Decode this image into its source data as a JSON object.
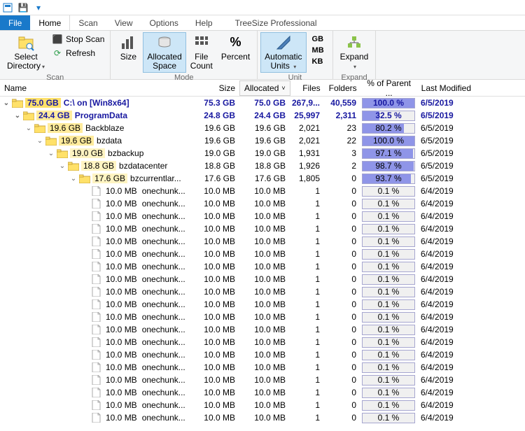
{
  "qa": {
    "save": "💾",
    "undo": "↶",
    "redo": "↷"
  },
  "menu": {
    "file": "File",
    "home": "Home",
    "scan": "Scan",
    "view": "View",
    "options": "Options",
    "help": "Help",
    "title": "TreeSize Professional"
  },
  "ribbon": {
    "select_dir": "Select\nDirectory",
    "stop_scan": "Stop Scan",
    "refresh": "Refresh",
    "scan_label": "Scan",
    "size": "Size",
    "alloc_space": "Allocated\nSpace",
    "file_count": "File\nCount",
    "percent": "Percent",
    "mode_label": "Mode",
    "auto_units": "Automatic\nUnits",
    "gb": "GB",
    "mb": "MB",
    "kb": "KB",
    "unit_label": "Unit",
    "expand": "Expand",
    "expand_label": "Expand"
  },
  "columns": {
    "name": "Name",
    "size": "Size",
    "alloc": "Allocated",
    "files": "Files",
    "folders": "Folders",
    "pct": "% of Parent ...",
    "mod": "Last Modified"
  },
  "rows": [
    {
      "type": "folder",
      "depth": 0,
      "chev": "v",
      "bg": "yellow",
      "bold": true,
      "size": "75.0 GB",
      "name": "C:\\ on  [Win8x64]",
      "c_size": "75.3 GB",
      "alloc": "75.0 GB",
      "files": "267,9...",
      "folders": "40,559",
      "pct": "100.0 %",
      "fill": 100,
      "mod": "6/5/2019"
    },
    {
      "type": "folder",
      "depth": 1,
      "chev": "v",
      "bg": "ltyellow",
      "bold": true,
      "size": "24.4 GB",
      "name": "ProgramData",
      "c_size": "24.8 GB",
      "alloc": "24.4 GB",
      "files": "25,997",
      "folders": "2,311",
      "pct": "32.5 %",
      "fill": 32.5,
      "mod": "6/5/2019"
    },
    {
      "type": "folder",
      "depth": 2,
      "chev": "v",
      "bg": "ltyellow",
      "bold": false,
      "size": "19.6 GB",
      "name": "Backblaze",
      "c_size": "19.6 GB",
      "alloc": "19.6 GB",
      "files": "2,021",
      "folders": "23",
      "pct": "80.2 %",
      "fill": 80.2,
      "mod": "6/5/2019"
    },
    {
      "type": "folder",
      "depth": 3,
      "chev": "v",
      "bg": "ltyellow",
      "bold": false,
      "size": "19.6 GB",
      "name": "bzdata",
      "c_size": "19.6 GB",
      "alloc": "19.6 GB",
      "files": "2,021",
      "folders": "22",
      "pct": "100.0 %",
      "fill": 100,
      "mod": "6/5/2019"
    },
    {
      "type": "folder",
      "depth": 4,
      "chev": "v",
      "bg": "vlyellow",
      "bold": false,
      "size": "19.0 GB",
      "name": "bzbackup",
      "c_size": "19.0 GB",
      "alloc": "19.0 GB",
      "files": "1,931",
      "folders": "3",
      "pct": "97.1 %",
      "fill": 97.1,
      "mod": "6/5/2019"
    },
    {
      "type": "folder",
      "depth": 5,
      "chev": "v",
      "bg": "vlyellow",
      "bold": false,
      "size": "18.8 GB",
      "name": "bzdatacenter",
      "c_size": "18.8 GB",
      "alloc": "18.8 GB",
      "files": "1,926",
      "folders": "2",
      "pct": "98.7 %",
      "fill": 98.7,
      "mod": "6/5/2019"
    },
    {
      "type": "folder",
      "depth": 6,
      "chev": "v",
      "bg": "vlyellow",
      "bold": false,
      "size": "17.6 GB",
      "name": "bzcurrentlar...",
      "c_size": "17.6 GB",
      "alloc": "17.6 GB",
      "files": "1,805",
      "folders": "0",
      "pct": "93.7 %",
      "fill": 93.7,
      "mod": "6/5/2019"
    },
    {
      "type": "file",
      "depth": 7,
      "size": "10.0 MB",
      "name": "onechunk...",
      "c_size": "10.0 MB",
      "alloc": "10.0 MB",
      "files": "1",
      "folders": "0",
      "pct": "0.1 %",
      "fill": 0.1,
      "mod": "6/4/2019"
    },
    {
      "type": "file",
      "depth": 7,
      "size": "10.0 MB",
      "name": "onechunk...",
      "c_size": "10.0 MB",
      "alloc": "10.0 MB",
      "files": "1",
      "folders": "0",
      "pct": "0.1 %",
      "fill": 0.1,
      "mod": "6/4/2019"
    },
    {
      "type": "file",
      "depth": 7,
      "size": "10.0 MB",
      "name": "onechunk...",
      "c_size": "10.0 MB",
      "alloc": "10.0 MB",
      "files": "1",
      "folders": "0",
      "pct": "0.1 %",
      "fill": 0.1,
      "mod": "6/4/2019"
    },
    {
      "type": "file",
      "depth": 7,
      "size": "10.0 MB",
      "name": "onechunk...",
      "c_size": "10.0 MB",
      "alloc": "10.0 MB",
      "files": "1",
      "folders": "0",
      "pct": "0.1 %",
      "fill": 0.1,
      "mod": "6/4/2019"
    },
    {
      "type": "file",
      "depth": 7,
      "size": "10.0 MB",
      "name": "onechunk...",
      "c_size": "10.0 MB",
      "alloc": "10.0 MB",
      "files": "1",
      "folders": "0",
      "pct": "0.1 %",
      "fill": 0.1,
      "mod": "6/4/2019"
    },
    {
      "type": "file",
      "depth": 7,
      "size": "10.0 MB",
      "name": "onechunk...",
      "c_size": "10.0 MB",
      "alloc": "10.0 MB",
      "files": "1",
      "folders": "0",
      "pct": "0.1 %",
      "fill": 0.1,
      "mod": "6/4/2019"
    },
    {
      "type": "file",
      "depth": 7,
      "size": "10.0 MB",
      "name": "onechunk...",
      "c_size": "10.0 MB",
      "alloc": "10.0 MB",
      "files": "1",
      "folders": "0",
      "pct": "0.1 %",
      "fill": 0.1,
      "mod": "6/4/2019"
    },
    {
      "type": "file",
      "depth": 7,
      "size": "10.0 MB",
      "name": "onechunk...",
      "c_size": "10.0 MB",
      "alloc": "10.0 MB",
      "files": "1",
      "folders": "0",
      "pct": "0.1 %",
      "fill": 0.1,
      "mod": "6/4/2019"
    },
    {
      "type": "file",
      "depth": 7,
      "size": "10.0 MB",
      "name": "onechunk...",
      "c_size": "10.0 MB",
      "alloc": "10.0 MB",
      "files": "1",
      "folders": "0",
      "pct": "0.1 %",
      "fill": 0.1,
      "mod": "6/4/2019"
    },
    {
      "type": "file",
      "depth": 7,
      "size": "10.0 MB",
      "name": "onechunk...",
      "c_size": "10.0 MB",
      "alloc": "10.0 MB",
      "files": "1",
      "folders": "0",
      "pct": "0.1 %",
      "fill": 0.1,
      "mod": "6/4/2019"
    },
    {
      "type": "file",
      "depth": 7,
      "size": "10.0 MB",
      "name": "onechunk...",
      "c_size": "10.0 MB",
      "alloc": "10.0 MB",
      "files": "1",
      "folders": "0",
      "pct": "0.1 %",
      "fill": 0.1,
      "mod": "6/4/2019"
    },
    {
      "type": "file",
      "depth": 7,
      "size": "10.0 MB",
      "name": "onechunk...",
      "c_size": "10.0 MB",
      "alloc": "10.0 MB",
      "files": "1",
      "folders": "0",
      "pct": "0.1 %",
      "fill": 0.1,
      "mod": "6/4/2019"
    },
    {
      "type": "file",
      "depth": 7,
      "size": "10.0 MB",
      "name": "onechunk...",
      "c_size": "10.0 MB",
      "alloc": "10.0 MB",
      "files": "1",
      "folders": "0",
      "pct": "0.1 %",
      "fill": 0.1,
      "mod": "6/4/2019"
    },
    {
      "type": "file",
      "depth": 7,
      "size": "10.0 MB",
      "name": "onechunk...",
      "c_size": "10.0 MB",
      "alloc": "10.0 MB",
      "files": "1",
      "folders": "0",
      "pct": "0.1 %",
      "fill": 0.1,
      "mod": "6/4/2019"
    },
    {
      "type": "file",
      "depth": 7,
      "size": "10.0 MB",
      "name": "onechunk...",
      "c_size": "10.0 MB",
      "alloc": "10.0 MB",
      "files": "1",
      "folders": "0",
      "pct": "0.1 %",
      "fill": 0.1,
      "mod": "6/4/2019"
    },
    {
      "type": "file",
      "depth": 7,
      "size": "10.0 MB",
      "name": "onechunk...",
      "c_size": "10.0 MB",
      "alloc": "10.0 MB",
      "files": "1",
      "folders": "0",
      "pct": "0.1 %",
      "fill": 0.1,
      "mod": "6/4/2019"
    },
    {
      "type": "file",
      "depth": 7,
      "size": "10.0 MB",
      "name": "onechunk...",
      "c_size": "10.0 MB",
      "alloc": "10.0 MB",
      "files": "1",
      "folders": "0",
      "pct": "0.1 %",
      "fill": 0.1,
      "mod": "6/4/2019"
    },
    {
      "type": "file",
      "depth": 7,
      "size": "10.0 MB",
      "name": "onechunk...",
      "c_size": "10.0 MB",
      "alloc": "10.0 MB",
      "files": "1",
      "folders": "0",
      "pct": "0.1 %",
      "fill": 0.1,
      "mod": "6/4/2019"
    },
    {
      "type": "file",
      "depth": 7,
      "size": "10.0 MB",
      "name": "onechunk...",
      "c_size": "10.0 MB",
      "alloc": "10.0 MB",
      "files": "1",
      "folders": "0",
      "pct": "0.1 %",
      "fill": 0.1,
      "mod": "6/4/2019"
    }
  ]
}
